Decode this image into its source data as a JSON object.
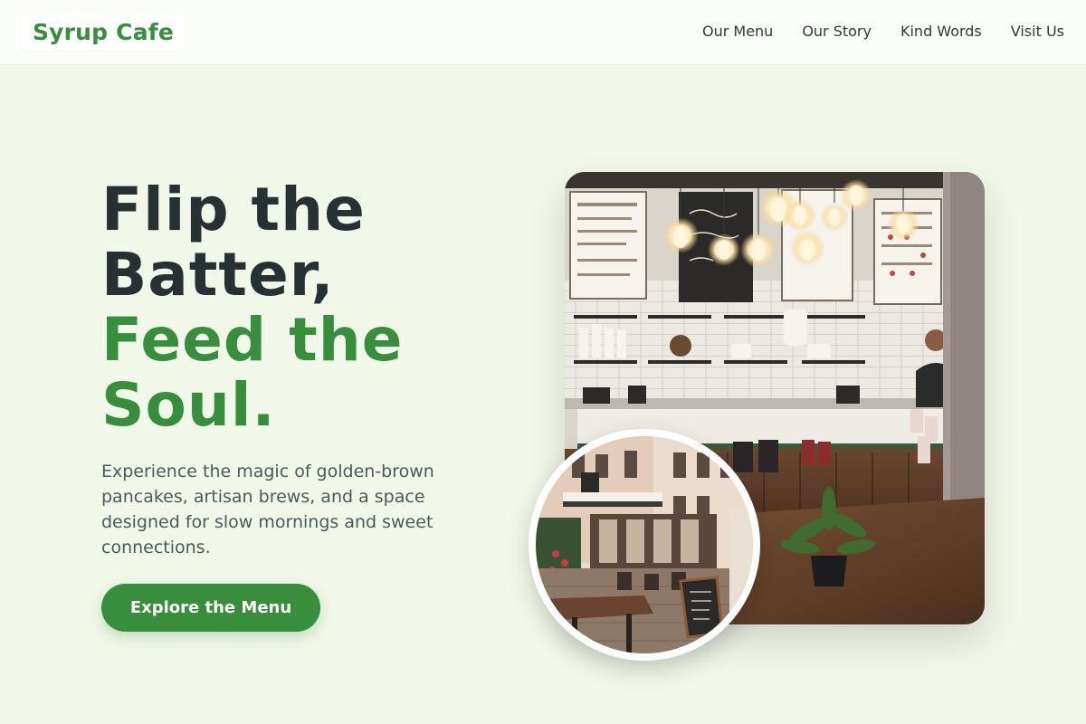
{
  "header": {
    "logo": "Syrup Cafe",
    "nav": [
      {
        "label": "Our Menu"
      },
      {
        "label": "Our Story"
      },
      {
        "label": "Kind Words"
      },
      {
        "label": "Visit Us"
      }
    ]
  },
  "hero": {
    "title_lines": [
      "Flip the",
      "Batter,"
    ],
    "title_accent_lines": [
      "Feed the",
      "Soul."
    ],
    "subtitle": "Experience the magic of golden-brown pancakes, artisan brews, and a space designed for slow mornings and sweet connections.",
    "cta_label": "Explore the Menu"
  },
  "colors": {
    "brand_green": "#388e3c",
    "page_background": "#f1f7e9",
    "heading_dark": "#273033"
  }
}
